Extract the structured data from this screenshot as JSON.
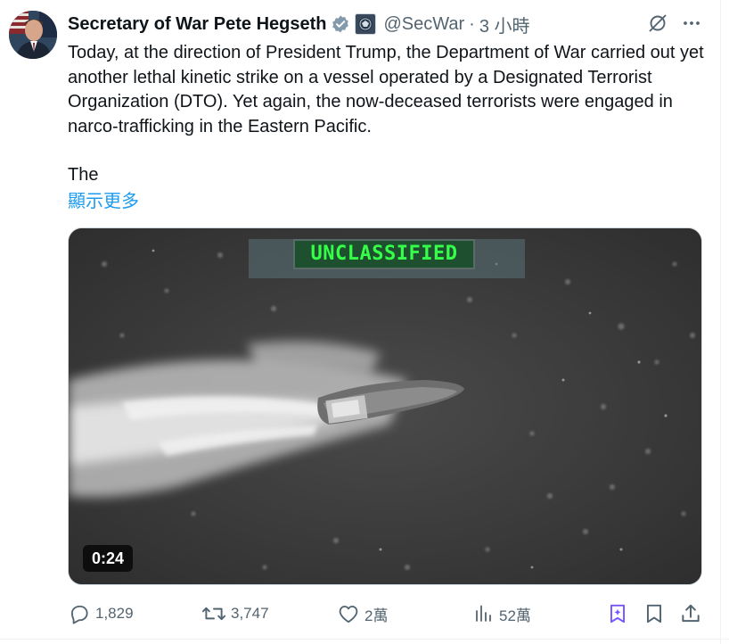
{
  "tweet": {
    "author": {
      "display_name": "Secretary of War Pete Hegseth",
      "handle": "@SecWar",
      "verified_icon": "verified-badge-icon",
      "affiliation_icon": "department-of-war-seal-icon"
    },
    "separator": "·",
    "time": "3 小時",
    "text_main": "Today, at the direction of President Trump, the Department of War carried out yet another lethal kinetic strike on a vessel operated by a Designated Terrorist Organization (DTO). Yet again, the now-deceased terrorists were engaged in narco-trafficking in the Eastern Pacific.",
    "text_cont": "The",
    "show_more": "顯示更多",
    "media": {
      "overlay_label": "UNCLASSIFIED",
      "duration": "0:24"
    },
    "stats": {
      "replies": "1,829",
      "reposts": "3,747",
      "likes": "2萬",
      "views": "52萬"
    }
  },
  "colors": {
    "accent": "#1d9bf0",
    "muted": "#536471",
    "text": "#0f1419",
    "grok_purple": "#7856ff"
  }
}
